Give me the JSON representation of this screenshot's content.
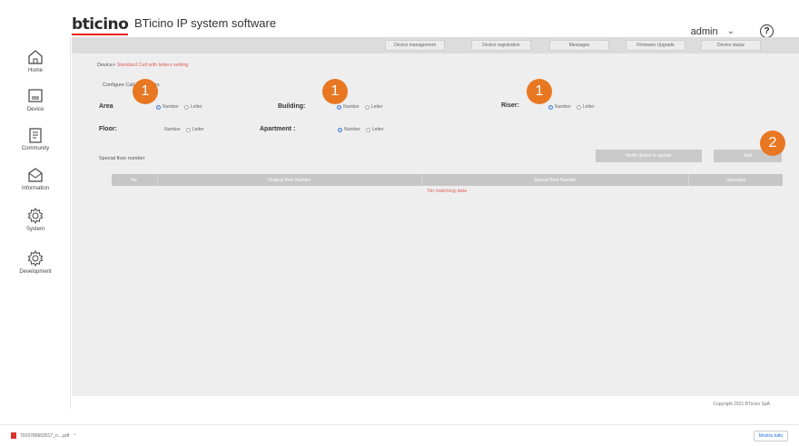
{
  "header": {
    "logo_text": "bticino",
    "app_title": "BTicino IP system software",
    "user": "admin",
    "help_symbol": "?"
  },
  "sidebar": {
    "items": [
      {
        "label": "Home",
        "icon": "home-icon"
      },
      {
        "label": "Device",
        "icon": "device-icon"
      },
      {
        "label": "Community",
        "icon": "community-icon"
      },
      {
        "label": "Information",
        "icon": "information-icon"
      },
      {
        "label": "System",
        "icon": "gear-icon"
      },
      {
        "label": "Development",
        "icon": "gear-icon"
      }
    ]
  },
  "nav": {
    "buttons": [
      "Device management",
      "Device registration",
      "Messages",
      "Firmware Upgrade",
      "Device status"
    ]
  },
  "breadcrumb": {
    "root": "Device",
    "current": "Standard Call with letters setting"
  },
  "config": {
    "title": "Configure Call with letters",
    "fields": [
      {
        "label": "Area",
        "options": [
          "Number",
          "Letter"
        ],
        "selected": "Number"
      },
      {
        "label": "Building:",
        "options": [
          "Number",
          "Letter"
        ],
        "selected": "Number"
      },
      {
        "label": "Riser:",
        "options": [
          "Number",
          "Letter"
        ],
        "selected": "Number"
      },
      {
        "label": "Floor:",
        "options": [
          "Number",
          "Letter"
        ],
        "selected": "none"
      },
      {
        "label": "Apartment :",
        "options": [
          "Number",
          "Letter"
        ],
        "selected": "Number"
      }
    ]
  },
  "special": {
    "label": "Special floor number",
    "notify_button": "Notify device to update",
    "add_button": "Add"
  },
  "table": {
    "columns": [
      "No.",
      "Original floor Number",
      "Special floor Number",
      "Operation"
    ],
    "empty_text": "No matching data"
  },
  "footer": {
    "copyright": "Copyright 2021 BTicino SpA"
  },
  "badges": [
    "1",
    "1",
    "1",
    "2"
  ],
  "downloads": {
    "file": "7010780602017_n....pdf",
    "show_all": "Mostra tutto"
  },
  "colors": {
    "accent_orange": "#e87722",
    "error_red": "#e0605a",
    "radio_blue": "#3b79d8"
  }
}
